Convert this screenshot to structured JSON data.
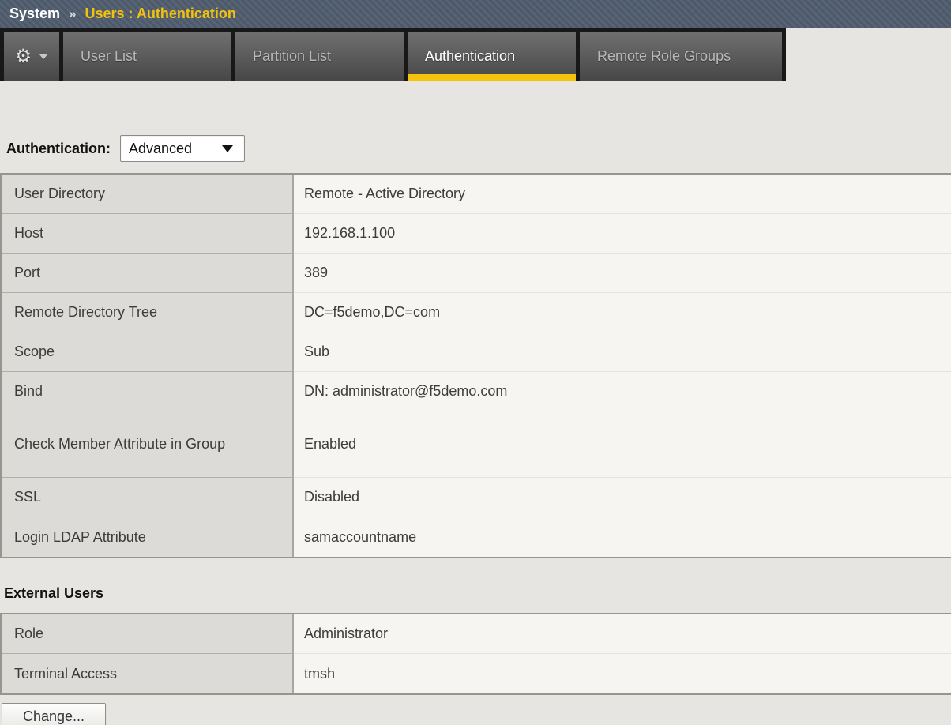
{
  "breadcrumb": {
    "section": "System",
    "separator": "»",
    "page": "Users : Authentication"
  },
  "tabs": [
    {
      "label": "User List",
      "active": false
    },
    {
      "label": "Partition List",
      "active": false
    },
    {
      "label": "Authentication",
      "active": true
    },
    {
      "label": "Remote Role Groups",
      "active": false
    }
  ],
  "gear_menu": {
    "icon": "gear-icon",
    "caret": "chevron-down-icon"
  },
  "auth_selector": {
    "label": "Authentication:",
    "value": "Advanced"
  },
  "settings_table": {
    "rows": [
      {
        "label": "User Directory",
        "value": "Remote - Active Directory"
      },
      {
        "label": "Host",
        "value": "192.168.1.100"
      },
      {
        "label": "Port",
        "value": "389"
      },
      {
        "label": "Remote Directory Tree",
        "value": "DC=f5demo,DC=com"
      },
      {
        "label": "Scope",
        "value": "Sub"
      },
      {
        "label": "Bind",
        "value": "DN: administrator@f5demo.com"
      },
      {
        "label": "Check Member Attribute in Group",
        "value": "Enabled",
        "tall": true
      },
      {
        "label": "SSL",
        "value": "Disabled"
      },
      {
        "label": "Login LDAP Attribute",
        "value": "samaccountname"
      }
    ]
  },
  "external_users": {
    "heading": "External Users",
    "rows": [
      {
        "label": "Role",
        "value": "Administrator"
      },
      {
        "label": "Terminal Access",
        "value": "tmsh"
      }
    ]
  },
  "change_button_label": "Change...",
  "colors": {
    "accent_yellow": "#f5c40a",
    "breadcrumb_bg": "#515c6a",
    "tab_bg_dark": "#181818",
    "label_cell_bg": "#dcdbd7",
    "value_cell_bg": "#f6f5f2"
  }
}
